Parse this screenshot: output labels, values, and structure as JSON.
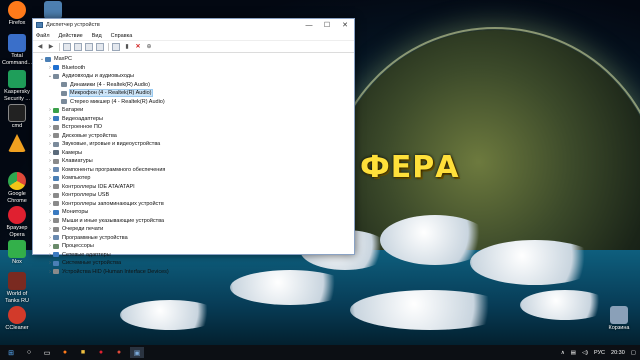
{
  "wallpaper": {
    "logo_text": "ФЕРА"
  },
  "desktop_icons": [
    {
      "label": "Firefox",
      "color": "#ff7a1a"
    },
    {
      "label": "Total Command...",
      "color": "#3a6fc9"
    },
    {
      "label": "Kaspersky Security ...",
      "color": "#1f9e5a"
    },
    {
      "label": "cmd",
      "color": "#222222"
    },
    {
      "label": "",
      "color": "#f0a020"
    },
    {
      "label": "Google Chrome",
      "color": "#e04a3a"
    },
    {
      "label": "Браузер Opera",
      "color": "#e02030"
    },
    {
      "label": "Nox",
      "color": "#33b04a"
    },
    {
      "label": "World of Tanks RU",
      "color": "#7a2a20"
    },
    {
      "label": "CCleaner",
      "color": "#d23a2a"
    },
    {
      "label": "Корзина",
      "color": "#8aa0b8"
    }
  ],
  "window": {
    "title": "Диспетчер устройств",
    "controls": {
      "minimize": "—",
      "maximize": "☐",
      "close": "✕"
    },
    "menu": [
      "Файл",
      "Действие",
      "Вид",
      "Справка"
    ],
    "tree": [
      {
        "text": "MaxPC",
        "level": 0,
        "expanded": true,
        "color": "#4a7fb5"
      },
      {
        "text": "Bluetooth",
        "level": 1,
        "expanded": false,
        "color": "#1f6fd0"
      },
      {
        "text": "Аудиовходы и аудиовыходы",
        "level": 1,
        "expanded": true,
        "color": "#7a8a9a"
      },
      {
        "text": "Динамики (4 - Realtek(R) Audio)",
        "level": 2,
        "expanded": null,
        "color": "#7a8a9a"
      },
      {
        "text": "Микрофон (4 - Realtek(R) Audio)",
        "level": 2,
        "expanded": null,
        "color": "#7a8a9a",
        "selected": true
      },
      {
        "text": "Стерео микшер (4 - Realtek(R) Audio)",
        "level": 2,
        "expanded": null,
        "color": "#7a8a9a"
      },
      {
        "text": "Батареи",
        "level": 1,
        "expanded": false,
        "color": "#3aa04a"
      },
      {
        "text": "Видеоадаптеры",
        "level": 1,
        "expanded": false,
        "color": "#3a7ac0"
      },
      {
        "text": "Встроенное ПО",
        "level": 1,
        "expanded": false,
        "color": "#8a8a8a"
      },
      {
        "text": "Дисковые устройства",
        "level": 1,
        "expanded": false,
        "color": "#8a8a8a"
      },
      {
        "text": "Звуковые, игровые и видеоустройства",
        "level": 1,
        "expanded": false,
        "color": "#7a8a9a"
      },
      {
        "text": "Камеры",
        "level": 1,
        "expanded": false,
        "color": "#5a6a7a"
      },
      {
        "text": "Клавиатуры",
        "level": 1,
        "expanded": false,
        "color": "#8a8a8a"
      },
      {
        "text": "Компоненты программного обеспечения",
        "level": 1,
        "expanded": false,
        "color": "#6a8ab0"
      },
      {
        "text": "Компьютер",
        "level": 1,
        "expanded": false,
        "color": "#4a7fb5"
      },
      {
        "text": "Контроллеры IDE ATA/ATAPI",
        "level": 1,
        "expanded": false,
        "color": "#8a8a8a"
      },
      {
        "text": "Контроллеры USB",
        "level": 1,
        "expanded": false,
        "color": "#8a8a8a"
      },
      {
        "text": "Контроллеры запоминающих устройств",
        "level": 1,
        "expanded": false,
        "color": "#8a8a8a"
      },
      {
        "text": "Мониторы",
        "level": 1,
        "expanded": false,
        "color": "#3a7ac0"
      },
      {
        "text": "Мыши и иные указывающие устройства",
        "level": 1,
        "expanded": false,
        "color": "#8a8a8a"
      },
      {
        "text": "Очереди печати",
        "level": 1,
        "expanded": false,
        "color": "#8a8a8a"
      },
      {
        "text": "Программные устройства",
        "level": 1,
        "expanded": false,
        "color": "#6a8ab0"
      },
      {
        "text": "Процессоры",
        "level": 1,
        "expanded": false,
        "color": "#6a8a6a"
      },
      {
        "text": "Сетевые адаптеры",
        "level": 1,
        "expanded": false,
        "color": "#3a7ac0"
      },
      {
        "text": "Системные устройства",
        "level": 1,
        "expanded": false,
        "color": "#4a7fb5"
      },
      {
        "text": "Устройства HID (Human Interface Devices)",
        "level": 1,
        "expanded": false,
        "color": "#8a8a8a"
      }
    ]
  },
  "taskbar": {
    "tray_lang": "РУС",
    "time": "20:30"
  }
}
